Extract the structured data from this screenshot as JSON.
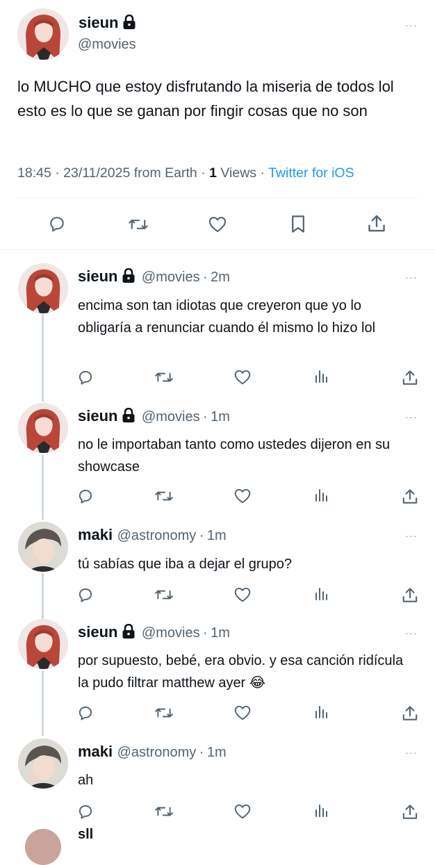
{
  "main_tweet": {
    "name": "sieun",
    "handle": "@movies",
    "text": "lo MUCHO que estoy disfrutando la miseria de todos lol esto es lo que se ganan por fingir cosas que no son",
    "time": "18:45",
    "date": "23/11/2025",
    "location": "from Earth",
    "views_count": "1",
    "views_label": "Views",
    "client": "Twitter for iOS"
  },
  "replies": [
    {
      "name": "sieun",
      "handle": "@movies",
      "time": "2m",
      "text": "encima son tan idiotas que creyeron que yo lo obligaría a renunciar cuando él mismo lo hizo lol"
    },
    {
      "name": "sieun",
      "handle": "@movies",
      "time": "1m",
      "text": "no le importaban tanto como ustedes dijeron en su showcase"
    },
    {
      "name": "maki",
      "handle": "@astronomy",
      "time": "1m",
      "text": "tú sabías que iba a dejar el grupo?"
    },
    {
      "name": "sieun",
      "handle": "@movies",
      "time": "1m",
      "text": "por supuesto, bebé, era obvio. y esa canción ridícula la pudo filtrar matthew ayer 😂"
    },
    {
      "name": "maki",
      "handle": "@astronomy",
      "time": "1m",
      "text": "ah"
    }
  ],
  "partial_next": {
    "name": "sll"
  },
  "ui": {
    "separator": "·",
    "more": "···"
  },
  "colors": {
    "link": "#1d9bf0",
    "secondary": "#536471",
    "divider": "#eff3f4",
    "thread": "#cfd9de"
  }
}
